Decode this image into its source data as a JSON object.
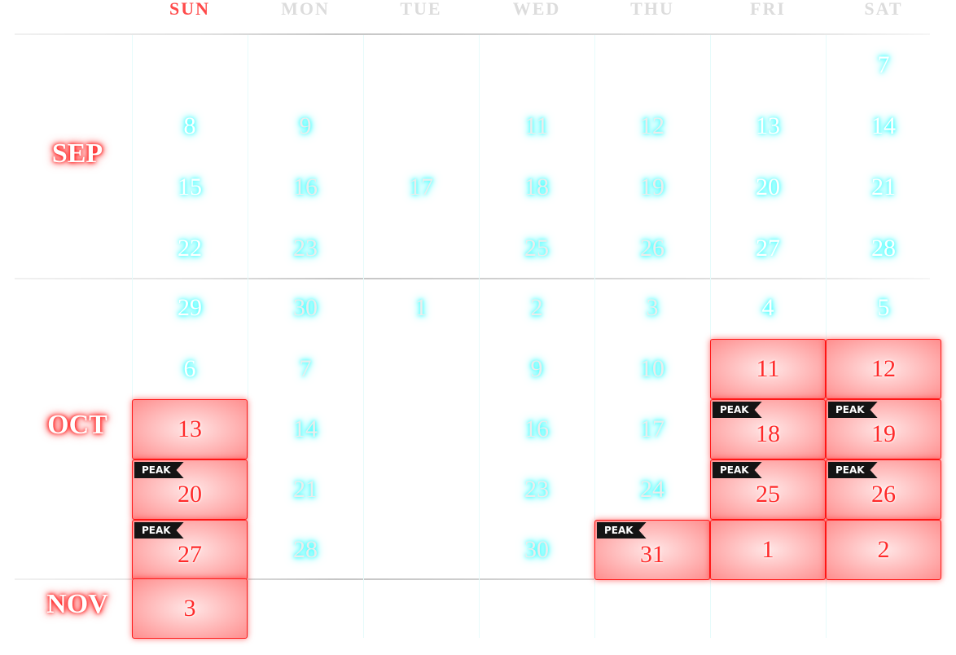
{
  "weekdays": [
    {
      "label": "SUN",
      "highlight": true
    },
    {
      "label": "MON",
      "highlight": false
    },
    {
      "label": "TUE",
      "highlight": false
    },
    {
      "label": "WED",
      "highlight": false
    },
    {
      "label": "THU",
      "highlight": false
    },
    {
      "label": "FRI",
      "highlight": false
    },
    {
      "label": "SAT",
      "highlight": false
    }
  ],
  "months": [
    {
      "label": "SEP",
      "row": 1.5
    },
    {
      "label": "OCT",
      "row": 6
    },
    {
      "label": "NOV",
      "row": 9
    }
  ],
  "badge_label": "PEAK",
  "colors": {
    "accent": "#ff1a1a",
    "glow": "#33ffff",
    "weekday": "#dcdcdc",
    "sunday": "#ff4a4a"
  },
  "weeks": [
    [
      null,
      null,
      null,
      null,
      null,
      null,
      {
        "d": "7"
      }
    ],
    [
      {
        "d": "8"
      },
      {
        "d": "9",
        "dim": true
      },
      null,
      {
        "d": "11",
        "dim": true
      },
      {
        "d": "12",
        "dim": true
      },
      {
        "d": "13"
      },
      {
        "d": "14"
      }
    ],
    [
      {
        "d": "15"
      },
      {
        "d": "16",
        "dim": true
      },
      {
        "d": "17",
        "dim": true
      },
      {
        "d": "18",
        "dim": true
      },
      {
        "d": "19",
        "dim": true
      },
      {
        "d": "20"
      },
      {
        "d": "21"
      }
    ],
    [
      {
        "d": "22"
      },
      {
        "d": "23",
        "dim": true
      },
      null,
      {
        "d": "25",
        "dim": true
      },
      {
        "d": "26",
        "dim": true
      },
      {
        "d": "27"
      },
      {
        "d": "28"
      }
    ],
    [
      {
        "d": "29"
      },
      {
        "d": "30",
        "dim": true
      },
      {
        "d": "1",
        "dim": true
      },
      {
        "d": "2",
        "dim": true
      },
      {
        "d": "3",
        "dim": true
      },
      {
        "d": "4"
      },
      {
        "d": "5"
      }
    ],
    [
      {
        "d": "6"
      },
      {
        "d": "7",
        "dim": true
      },
      null,
      {
        "d": "9",
        "dim": true
      },
      {
        "d": "10",
        "dim": true
      },
      {
        "d": "11",
        "red": true
      },
      {
        "d": "12",
        "red": true
      }
    ],
    [
      {
        "d": "13",
        "red": true
      },
      {
        "d": "14",
        "dim": true
      },
      null,
      {
        "d": "16",
        "dim": true
      },
      {
        "d": "17",
        "dim": true
      },
      {
        "d": "18",
        "red": true,
        "peak": true
      },
      {
        "d": "19",
        "red": true,
        "peak": true
      }
    ],
    [
      {
        "d": "20",
        "red": true,
        "peak": true
      },
      {
        "d": "21",
        "dim": true
      },
      null,
      {
        "d": "23",
        "dim": true
      },
      {
        "d": "24",
        "dim": true
      },
      {
        "d": "25",
        "red": true,
        "peak": true
      },
      {
        "d": "26",
        "red": true,
        "peak": true
      }
    ],
    [
      {
        "d": "27",
        "red": true,
        "peak": true
      },
      {
        "d": "28",
        "dim": true
      },
      null,
      {
        "d": "30",
        "dim": true
      },
      {
        "d": "31",
        "red": true,
        "peak": true
      },
      {
        "d": "1",
        "red": true
      },
      {
        "d": "2",
        "red": true
      }
    ],
    [
      {
        "d": "3",
        "red": true
      },
      null,
      null,
      null,
      null,
      null,
      null
    ]
  ]
}
